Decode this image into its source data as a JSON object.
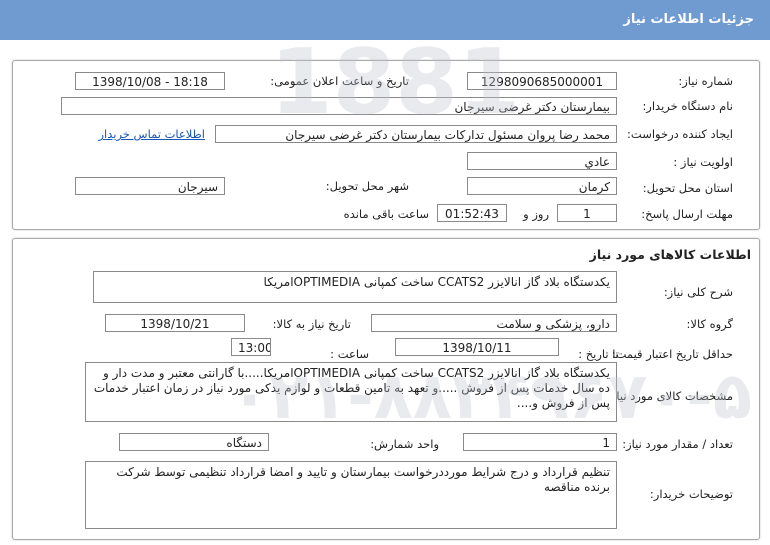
{
  "page_title": "جزئیات اطلاعات نیاز",
  "need_info": {
    "need_number_label": "شماره نیاز:",
    "need_number": "1298090685000001",
    "announce_label": "تاریخ و ساعت اعلان عمومی:",
    "announce_value": "1398/10/08 - 18:18",
    "buyer_org_label": "نام دستگاه خریدار:",
    "buyer_org": "بیمارستان دکتر غرضی سیرجان",
    "requester_label": "ایجاد کننده درخواست:",
    "requester": "محمد رضا پروان مسئول تدارکات بیمارستان دکتر غرضی سیرجان",
    "contact_link": "اطلاعات تماس خریدار",
    "priority_label": "اولویت نیاز :",
    "priority": "عادي",
    "province_label": "استان محل تحویل:",
    "province": "کرمان",
    "city_label": "شهر محل تحویل:",
    "city": "سیرجان",
    "deadline_label": "مهلت ارسال پاسخ:",
    "deadline_days": "1",
    "days_word": "روز و",
    "deadline_time": "01:52:43",
    "remaining_word": "ساعت باقی مانده"
  },
  "goods_info": {
    "section_title": "اطلاعات کالاهای مورد نیاز",
    "general_desc_label": "شرح کلی نیاز:",
    "general_desc": "یکدستگاه بلاد گاز انالایزر CCATS2 ساخت کمپانی OPTIMEDIAامریکا",
    "goods_group_label": "گروه کالا:",
    "goods_group": "دارو، پزشکی و سلامت",
    "need_date_label": "تاریخ نیاز به کالا:",
    "need_date": "1398/10/21",
    "min_validity_label": "حداقل تاریخ اعتبار قیمت:",
    "until_date_label": "تا تاریخ :",
    "until_date": "1398/10/11",
    "hour_label": "ساعت :",
    "hour": "13:00",
    "specs_label": "مشخصات کالای مورد نیاز:",
    "specs": "یکدستگاه بلاد گاز انالایزر CCATS2 ساخت کمپانی OPTIMEDIAامریکا.....با گارانتی معتبر و مدت دار و ده سال خدمات پس از فروش .....و تعهد به تامین قطعات و لوازم یدکی مورد نیاز در زمان اعتبار خدمات پس از فروش و....",
    "qty_label": "تعداد / مقدار مورد نیاز:",
    "qty": "1",
    "unit_label": "واحد شمارش:",
    "unit": "دستگاه",
    "buyer_notes_label": "توضیحات خریدار:",
    "buyer_notes": "تنظیم قرارداد و درج شرایط مورددرخواست بیمارستان و تایید و امضا قرارداد تنظیمی توسط شرکت برنده مناقصه"
  }
}
